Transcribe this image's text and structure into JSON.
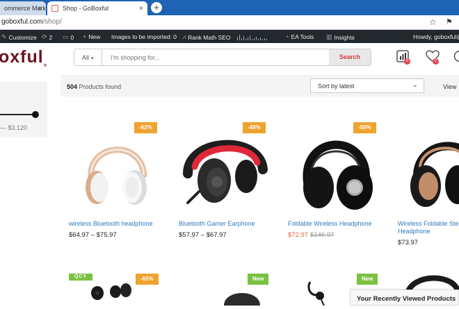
{
  "browser": {
    "tabs": [
      {
        "title": "ommerce Mark",
        "active": false
      },
      {
        "title": "Shop - GoBoxful",
        "active": true
      }
    ],
    "url_domain": "goboxful.com",
    "url_path": "/shop/"
  },
  "admin_bar": {
    "customize": "Customize",
    "updates": "2",
    "comments": "0",
    "new": "New",
    "images": "Images to be imported: 0",
    "rankmath": "Rank Math SEO",
    "ea_tools": "EA Tools",
    "insights": "Insights",
    "howdy": "Howdy, goboxful@"
  },
  "header": {
    "logo": "oxful",
    "search_category": "All",
    "search_placeholder": "I'm shopping for...",
    "search_button": "Search",
    "compare_count": "0",
    "wishlist_count": "0"
  },
  "sidebar": {
    "price_range": "— $3,120"
  },
  "toolbar": {
    "count_number": "504",
    "count_label": " Products found",
    "sort": "Sort by latest",
    "view": "View"
  },
  "products": [
    {
      "name": "wireless Bluetooth headphone",
      "price_low": "$64.97",
      "price_high": "$75.97",
      "discount": "-62%"
    },
    {
      "name": "Bluetooth Gamer Earphone",
      "price_low": "$57.97",
      "price_high": "$67.97",
      "discount": "-48%"
    },
    {
      "name": "Foldable Wireless Headphone",
      "price_sale": "$72.97",
      "price_old": "$146.97",
      "discount": "-50%"
    },
    {
      "name": "Wireless Foldable Ste",
      "name2": "Headphone",
      "price": "$73.97"
    }
  ],
  "row2": {
    "qcy_logo": "QCY",
    "discount": "-65%",
    "badge_new_1": "New",
    "badge_new_2": "New"
  },
  "recent_panel": "Your Recently Viewed Products",
  "colors": {
    "brand": "#6b1420",
    "discount": "#f0a22e",
    "new": "#7bc142",
    "link": "#2a7bc1",
    "sale": "#e9663d"
  }
}
